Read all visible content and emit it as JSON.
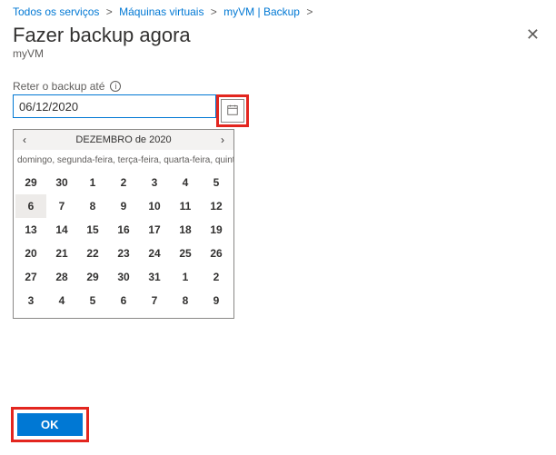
{
  "breadcrumb": {
    "item1": "Todos os serviços",
    "item2": "Máquinas virtuais",
    "item3": "myVM | Backup",
    "sep": ">"
  },
  "header": {
    "title": "Fazer backup agora",
    "subtitle": "myVM"
  },
  "field": {
    "label": "Reter o backup até",
    "info_glyph": "i",
    "value": "06/12/2020"
  },
  "calendar": {
    "month_label": "DEZEMBRO de 2020",
    "prev_glyph": "‹",
    "next_glyph": "›",
    "weekdays_line": "domingo, segunda-feira, terça-feira, quarta-feira, quinta-feira, sexta-feira, sábado",
    "rows": [
      [
        "29",
        "30",
        "1",
        "2",
        "3",
        "4",
        "5"
      ],
      [
        "6",
        "7",
        "8",
        "9",
        "10",
        "11",
        "12"
      ],
      [
        "13",
        "14",
        "15",
        "16",
        "17",
        "18",
        "19"
      ],
      [
        "20",
        "21",
        "22",
        "23",
        "24",
        "25",
        "26"
      ],
      [
        "27",
        "28",
        "29",
        "30",
        "31",
        "1",
        "2"
      ],
      [
        "3",
        "4",
        "5",
        "6",
        "7",
        "8",
        "9"
      ]
    ],
    "selected": "6"
  },
  "footer": {
    "ok_label": "OK"
  },
  "icons": {
    "close": "✕"
  }
}
